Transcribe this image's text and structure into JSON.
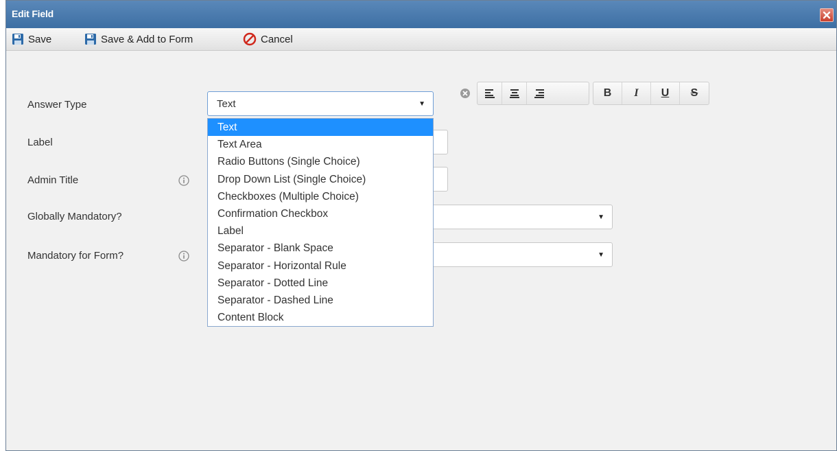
{
  "dialog": {
    "title": "Edit Field"
  },
  "toolbar": {
    "save_label": "Save",
    "save_add_label": "Save & Add to Form",
    "cancel_label": "Cancel"
  },
  "form": {
    "answer_type": {
      "label": "Answer Type",
      "value": "Text"
    },
    "label_field": {
      "label": "Label",
      "value": ""
    },
    "admin_title": {
      "label": "Admin Title",
      "value": ""
    },
    "globally_mandatory": {
      "label": "Globally Mandatory?",
      "value": ""
    },
    "mandatory_for_form": {
      "label": "Mandatory for Form?",
      "value": ""
    }
  },
  "format_buttons": {
    "bold": "B",
    "italic": "I",
    "underline": "U",
    "strike": "S"
  },
  "dropdown": {
    "selected_index": 0,
    "options": [
      "Text",
      "Text Area",
      "Radio Buttons (Single Choice)",
      "Drop Down List (Single Choice)",
      "Checkboxes (Multiple Choice)",
      "Confirmation Checkbox",
      "Label",
      "Separator - Blank Space",
      "Separator - Horizontal Rule",
      "Separator - Dotted Line",
      "Separator - Dashed Line",
      "Content Block"
    ]
  },
  "colors": {
    "titlebar": "#4a7cb0",
    "selected_option": "#1e90ff",
    "cancel_icon": "#d0281c"
  },
  "icons": {
    "save": "floppy-disk-icon",
    "cancel": "no-entry-icon",
    "info": "info-circle-icon",
    "close": "close-x-icon",
    "clear": "clear-circle-icon"
  }
}
